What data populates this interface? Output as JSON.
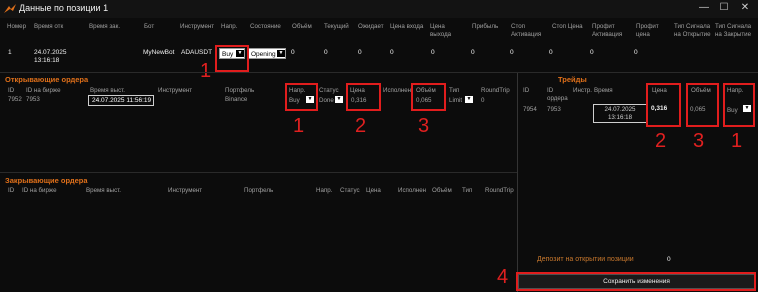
{
  "window": {
    "title": "Данные по позиции",
    "title_id": "1",
    "minimize": "—",
    "maximize": "☐",
    "close": "✕"
  },
  "position": {
    "headers": [
      "Номер",
      "Время отк",
      "Время зак.",
      "Бот",
      "Инструмент",
      "Напр.",
      "Состояние",
      "Объём",
      "Текущий",
      "Ожидает",
      "Цена входа",
      "Цена выхода",
      "Прибыль",
      "Стоп Активация",
      "Стоп Цена",
      "Профит Активация",
      "Профит цена",
      "Тип Сигнала на Открытие",
      "Тип Сигнала на Закрытие"
    ],
    "row": {
      "num": "1",
      "open_time": "24.07.2025 13:16:18",
      "close_time": "",
      "bot": "MyNewBot",
      "instrument": "ADAUSDT",
      "direction": "Buy",
      "state": "Opening",
      "volume": "0",
      "current": "0",
      "waiting": "0",
      "entry": "0",
      "exit": "0",
      "profit": "0",
      "stop_act": "0",
      "stop_price": "0",
      "profit_act": "0",
      "profit_price": "0",
      "open_signal": "",
      "close_signal": ""
    }
  },
  "opening_orders": {
    "title": "Открывающие ордера",
    "headers": {
      "id": "ID",
      "exchange_id": "ID на бирже",
      "time": "Время выст.",
      "instrument": "Инструмент",
      "portfolio": "Портфель",
      "direction": "Напр.",
      "status": "Статус",
      "price": "Цена",
      "executed": "Исполнен",
      "volume": "Объём",
      "type": "Тип",
      "roundtrip": "RoundTrip"
    },
    "row": {
      "id": "7952",
      "exchange_id": "7953",
      "time": "24.07.2025 11:56:19",
      "instrument": "",
      "portfolio": "Binance",
      "direction": "Buy",
      "status": "Done",
      "price": "0,316",
      "executed": "",
      "volume": "0,065",
      "type": "Limit",
      "roundtrip": "0"
    }
  },
  "closing_orders": {
    "title": "Закрывающие ордера",
    "headers": {
      "id": "ID",
      "exchange_id": "ID на бирже",
      "time": "Время выст.",
      "instrument": "Инструмент",
      "portfolio": "Портфель",
      "direction": "Напр.",
      "status": "Статус",
      "price": "Цена",
      "executed": "Исполнен",
      "volume": "Объём",
      "type": "Тип",
      "roundtrip": "RoundTrip"
    }
  },
  "trades": {
    "title": "Трейды",
    "headers": {
      "id": "ID",
      "order_id": "ID ордера",
      "instrument": "Инстр.",
      "time": "Время",
      "price": "Цена",
      "volume": "Объём",
      "direction": "Напр."
    },
    "row": {
      "id": "7954",
      "order_id": "7953",
      "instrument": "",
      "time": "24.07.2025 13:16:18",
      "price": "0,316",
      "volume": "0,065",
      "direction": "Buy"
    }
  },
  "deposit": {
    "label": "Депозит на открытии позиции",
    "value": "0"
  },
  "save_button": "Сохранить изменения",
  "annotations": [
    "1",
    "1",
    "2",
    "3",
    "2",
    "3",
    "1",
    "4"
  ],
  "colors": {
    "accent": "#e0701a",
    "annotation": "#e11d1d",
    "background": "#0c0c0c"
  }
}
